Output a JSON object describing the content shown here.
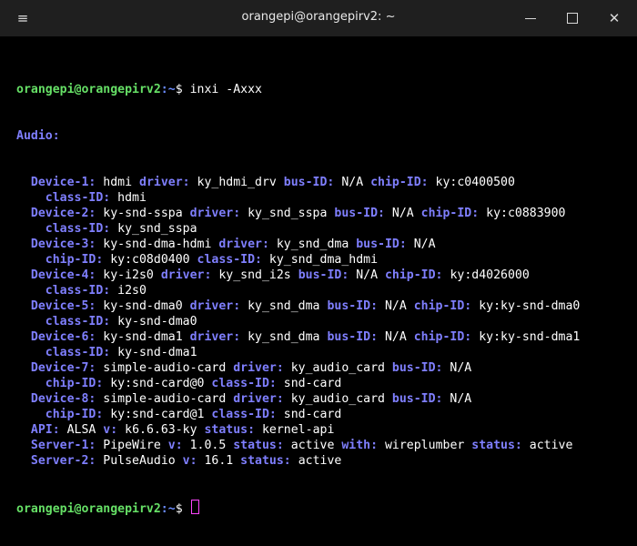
{
  "window": {
    "title": "orangepi@orangepirv2: ~",
    "menu_icon": "≡",
    "minimize_icon": "minimize-icon",
    "maximize_icon": "maximize-icon",
    "close_icon": "✕"
  },
  "prompt": {
    "user": "orangepi@orangepirv2",
    "path": ":~",
    "symbol": "$ ",
    "command": "inxi -Axxx"
  },
  "colors": {
    "prompt_user": "#66e066",
    "key": "#7f7fff",
    "cursor": "#ff44ff"
  },
  "output": {
    "section": "Audio:",
    "lines": [
      [
        {
          "i": "  ",
          "k": ""
        },
        {
          "k": "Device-1:",
          "v": " hdmi "
        },
        {
          "k": "driver:",
          "v": " ky_hdmi_drv "
        },
        {
          "k": "bus-ID:",
          "v": " N/A "
        },
        {
          "k": "chip-ID:",
          "v": " ky:c0400500"
        }
      ],
      [
        {
          "i": "    ",
          "k": ""
        },
        {
          "k": "class-ID:",
          "v": " hdmi"
        }
      ],
      [
        {
          "i": "  ",
          "k": ""
        },
        {
          "k": "Device-2:",
          "v": " ky-snd-sspa "
        },
        {
          "k": "driver:",
          "v": " ky_snd_sspa "
        },
        {
          "k": "bus-ID:",
          "v": " N/A "
        },
        {
          "k": "chip-ID:",
          "v": " ky:c0883900"
        }
      ],
      [
        {
          "i": "    ",
          "k": ""
        },
        {
          "k": "class-ID:",
          "v": " ky_snd_sspa"
        }
      ],
      [
        {
          "i": "  ",
          "k": ""
        },
        {
          "k": "Device-3:",
          "v": " ky-snd-dma-hdmi "
        },
        {
          "k": "driver:",
          "v": " ky_snd_dma "
        },
        {
          "k": "bus-ID:",
          "v": " N/A"
        }
      ],
      [
        {
          "i": "    ",
          "k": ""
        },
        {
          "k": "chip-ID:",
          "v": " ky:c08d0400 "
        },
        {
          "k": "class-ID:",
          "v": " ky_snd_dma_hdmi"
        }
      ],
      [
        {
          "i": "  ",
          "k": ""
        },
        {
          "k": "Device-4:",
          "v": " ky-i2s0 "
        },
        {
          "k": "driver:",
          "v": " ky_snd_i2s "
        },
        {
          "k": "bus-ID:",
          "v": " N/A "
        },
        {
          "k": "chip-ID:",
          "v": " ky:d4026000"
        }
      ],
      [
        {
          "i": "    ",
          "k": ""
        },
        {
          "k": "class-ID:",
          "v": " i2s0"
        }
      ],
      [
        {
          "i": "  ",
          "k": ""
        },
        {
          "k": "Device-5:",
          "v": " ky-snd-dma0 "
        },
        {
          "k": "driver:",
          "v": " ky_snd_dma "
        },
        {
          "k": "bus-ID:",
          "v": " N/A "
        },
        {
          "k": "chip-ID:",
          "v": " ky:ky-snd-dma0"
        }
      ],
      [
        {
          "i": "    ",
          "k": ""
        },
        {
          "k": "class-ID:",
          "v": " ky-snd-dma0"
        }
      ],
      [
        {
          "i": "  ",
          "k": ""
        },
        {
          "k": "Device-6:",
          "v": " ky-snd-dma1 "
        },
        {
          "k": "driver:",
          "v": " ky_snd_dma "
        },
        {
          "k": "bus-ID:",
          "v": " N/A "
        },
        {
          "k": "chip-ID:",
          "v": " ky:ky-snd-dma1"
        }
      ],
      [
        {
          "i": "    ",
          "k": ""
        },
        {
          "k": "class-ID:",
          "v": " ky-snd-dma1"
        }
      ],
      [
        {
          "i": "  ",
          "k": ""
        },
        {
          "k": "Device-7:",
          "v": " simple-audio-card "
        },
        {
          "k": "driver:",
          "v": " ky_audio_card "
        },
        {
          "k": "bus-ID:",
          "v": " N/A"
        }
      ],
      [
        {
          "i": "    ",
          "k": ""
        },
        {
          "k": "chip-ID:",
          "v": " ky:snd-card@0 "
        },
        {
          "k": "class-ID:",
          "v": " snd-card"
        }
      ],
      [
        {
          "i": "  ",
          "k": ""
        },
        {
          "k": "Device-8:",
          "v": " simple-audio-card "
        },
        {
          "k": "driver:",
          "v": " ky_audio_card "
        },
        {
          "k": "bus-ID:",
          "v": " N/A"
        }
      ],
      [
        {
          "i": "    ",
          "k": ""
        },
        {
          "k": "chip-ID:",
          "v": " ky:snd-card@1 "
        },
        {
          "k": "class-ID:",
          "v": " snd-card"
        }
      ],
      [
        {
          "i": "  ",
          "k": ""
        },
        {
          "k": "API:",
          "v": " ALSA "
        },
        {
          "k": "v:",
          "v": " k6.6.63-ky "
        },
        {
          "k": "status:",
          "v": " kernel-api"
        }
      ],
      [
        {
          "i": "  ",
          "k": ""
        },
        {
          "k": "Server-1:",
          "v": " PipeWire "
        },
        {
          "k": "v:",
          "v": " 1.0.5 "
        },
        {
          "k": "status:",
          "v": " active "
        },
        {
          "k": "with:",
          "v": " wireplumber "
        },
        {
          "k": "status:",
          "v": " active"
        }
      ],
      [
        {
          "i": "  ",
          "k": ""
        },
        {
          "k": "Server-2:",
          "v": " PulseAudio "
        },
        {
          "k": "v:",
          "v": " 16.1 "
        },
        {
          "k": "status:",
          "v": " active"
        }
      ]
    ]
  }
}
